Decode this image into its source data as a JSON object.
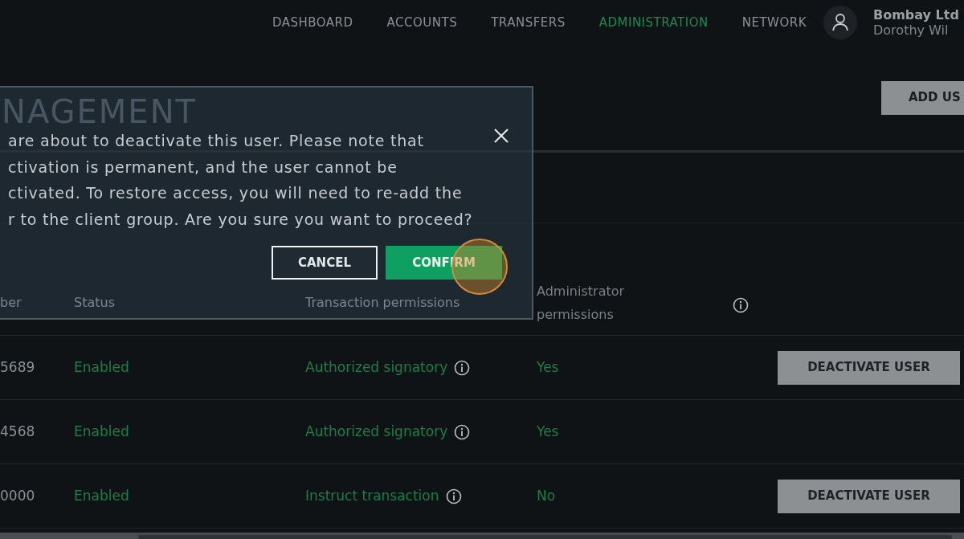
{
  "nav": {
    "items": [
      {
        "label": "DASHBOARD",
        "selected": false
      },
      {
        "label": "ACCOUNTS",
        "selected": false
      },
      {
        "label": "TRANSFERS",
        "selected": false
      },
      {
        "label": "ADMINISTRATION",
        "selected": true
      },
      {
        "label": "NETWORK",
        "selected": false
      }
    ],
    "user": {
      "company": "Bombay Ltd",
      "name": "Dorothy Wil"
    }
  },
  "page": {
    "title": "NAGEMENT",
    "add_button": "ADD US"
  },
  "table": {
    "columns": [
      "ber",
      "Status",
      "Transaction permissions",
      "Administrator permissions"
    ],
    "rows": [
      {
        "column_1": "5689",
        "status": "Enabled",
        "transaction": "Authorized signatory",
        "admin": "Yes",
        "action": "DEACTIVATE USER"
      },
      {
        "column_1": "4568",
        "status": "Enabled",
        "transaction": "Authorized signatory",
        "admin": "Yes"
      },
      {
        "column_1": "0000",
        "status": "Enabled",
        "transaction": "Instruct transaction",
        "admin": "No",
        "action": "DEACTIVATE USER"
      }
    ]
  },
  "modal": {
    "lines": [
      "are about to deactivate this user. Please note that",
      "ctivation is permanent, and the user cannot be",
      "ctivated. To restore access, you will need to re-add the",
      "r to the client group. Are you sure you want to proceed?"
    ],
    "buttons": [
      {
        "label": "CANCEL",
        "kind": "outline"
      },
      {
        "label": "CONFIRM",
        "kind": "primary"
      }
    ]
  }
}
